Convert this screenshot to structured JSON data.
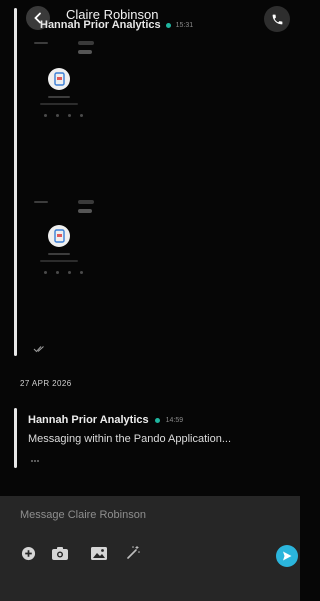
{
  "header": {
    "contact_name": "Claire Robinson"
  },
  "thread": {
    "sender": "Hannah Prior Analytics",
    "time": "15:31"
  },
  "date_separator": "27 APR 2026",
  "latest_message": {
    "sender": "Hannah Prior Analytics",
    "time": "14:59",
    "preview": "Messaging within the Pando Application..."
  },
  "composer": {
    "placeholder": "Message Claire Robinson",
    "tools": [
      "plus-icon",
      "camera-icon",
      "image-icon",
      "magic-wand-icon"
    ],
    "send_icon": "send-icon"
  },
  "colors": {
    "background": "#060606",
    "composer_bg": "#262626",
    "online_dot": "#1fb6a0",
    "send_button": "#2bb5dc"
  }
}
